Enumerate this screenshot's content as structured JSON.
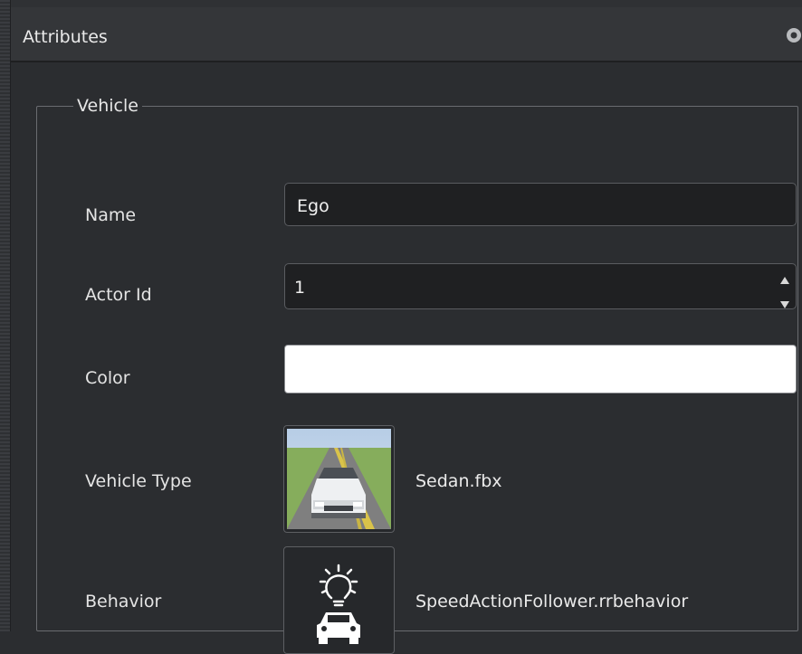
{
  "panel": {
    "title": "Attributes",
    "header_icon": "settings-dot-icon"
  },
  "group": {
    "legend": "Vehicle",
    "fields": {
      "name": {
        "label": "Name",
        "value": "Ego"
      },
      "actor_id": {
        "label": "Actor Id",
        "value": "1"
      },
      "color": {
        "label": "Color",
        "value": "#ffffff"
      },
      "vehicle_type": {
        "label": "Vehicle Type",
        "asset": "Sedan.fbx",
        "icon": "sedan-thumbnail"
      },
      "behavior": {
        "label": "Behavior",
        "asset": "SpeedActionFollower.rrbehavior",
        "icon": "behavior-lightbulb-car-icon"
      }
    }
  },
  "colors": {
    "background": "#2b2d30",
    "input_background": "#1f2022",
    "header_background": "#343639"
  }
}
